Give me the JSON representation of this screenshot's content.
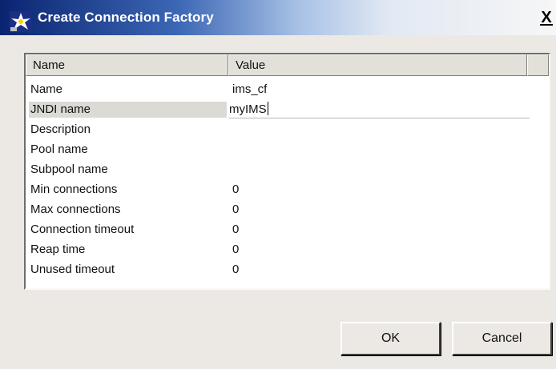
{
  "window": {
    "title": "Create Connection Factory",
    "close_label": "X"
  },
  "table": {
    "headers": [
      "Name",
      "Value"
    ],
    "rows": [
      {
        "name": "Name",
        "value": "ims_cf"
      },
      {
        "name": "JNDI name",
        "value": "myIMS"
      },
      {
        "name": "Description",
        "value": ""
      },
      {
        "name": "Pool name",
        "value": ""
      },
      {
        "name": "Subpool name",
        "value": ""
      },
      {
        "name": "Min connections",
        "value": "0"
      },
      {
        "name": "Max connections",
        "value": "0"
      },
      {
        "name": "Connection timeout",
        "value": "0"
      },
      {
        "name": "Reap time",
        "value": "0"
      },
      {
        "name": "Unused timeout",
        "value": "0"
      }
    ]
  },
  "buttons": {
    "ok_label": "OK",
    "cancel_label": "Cancel"
  }
}
